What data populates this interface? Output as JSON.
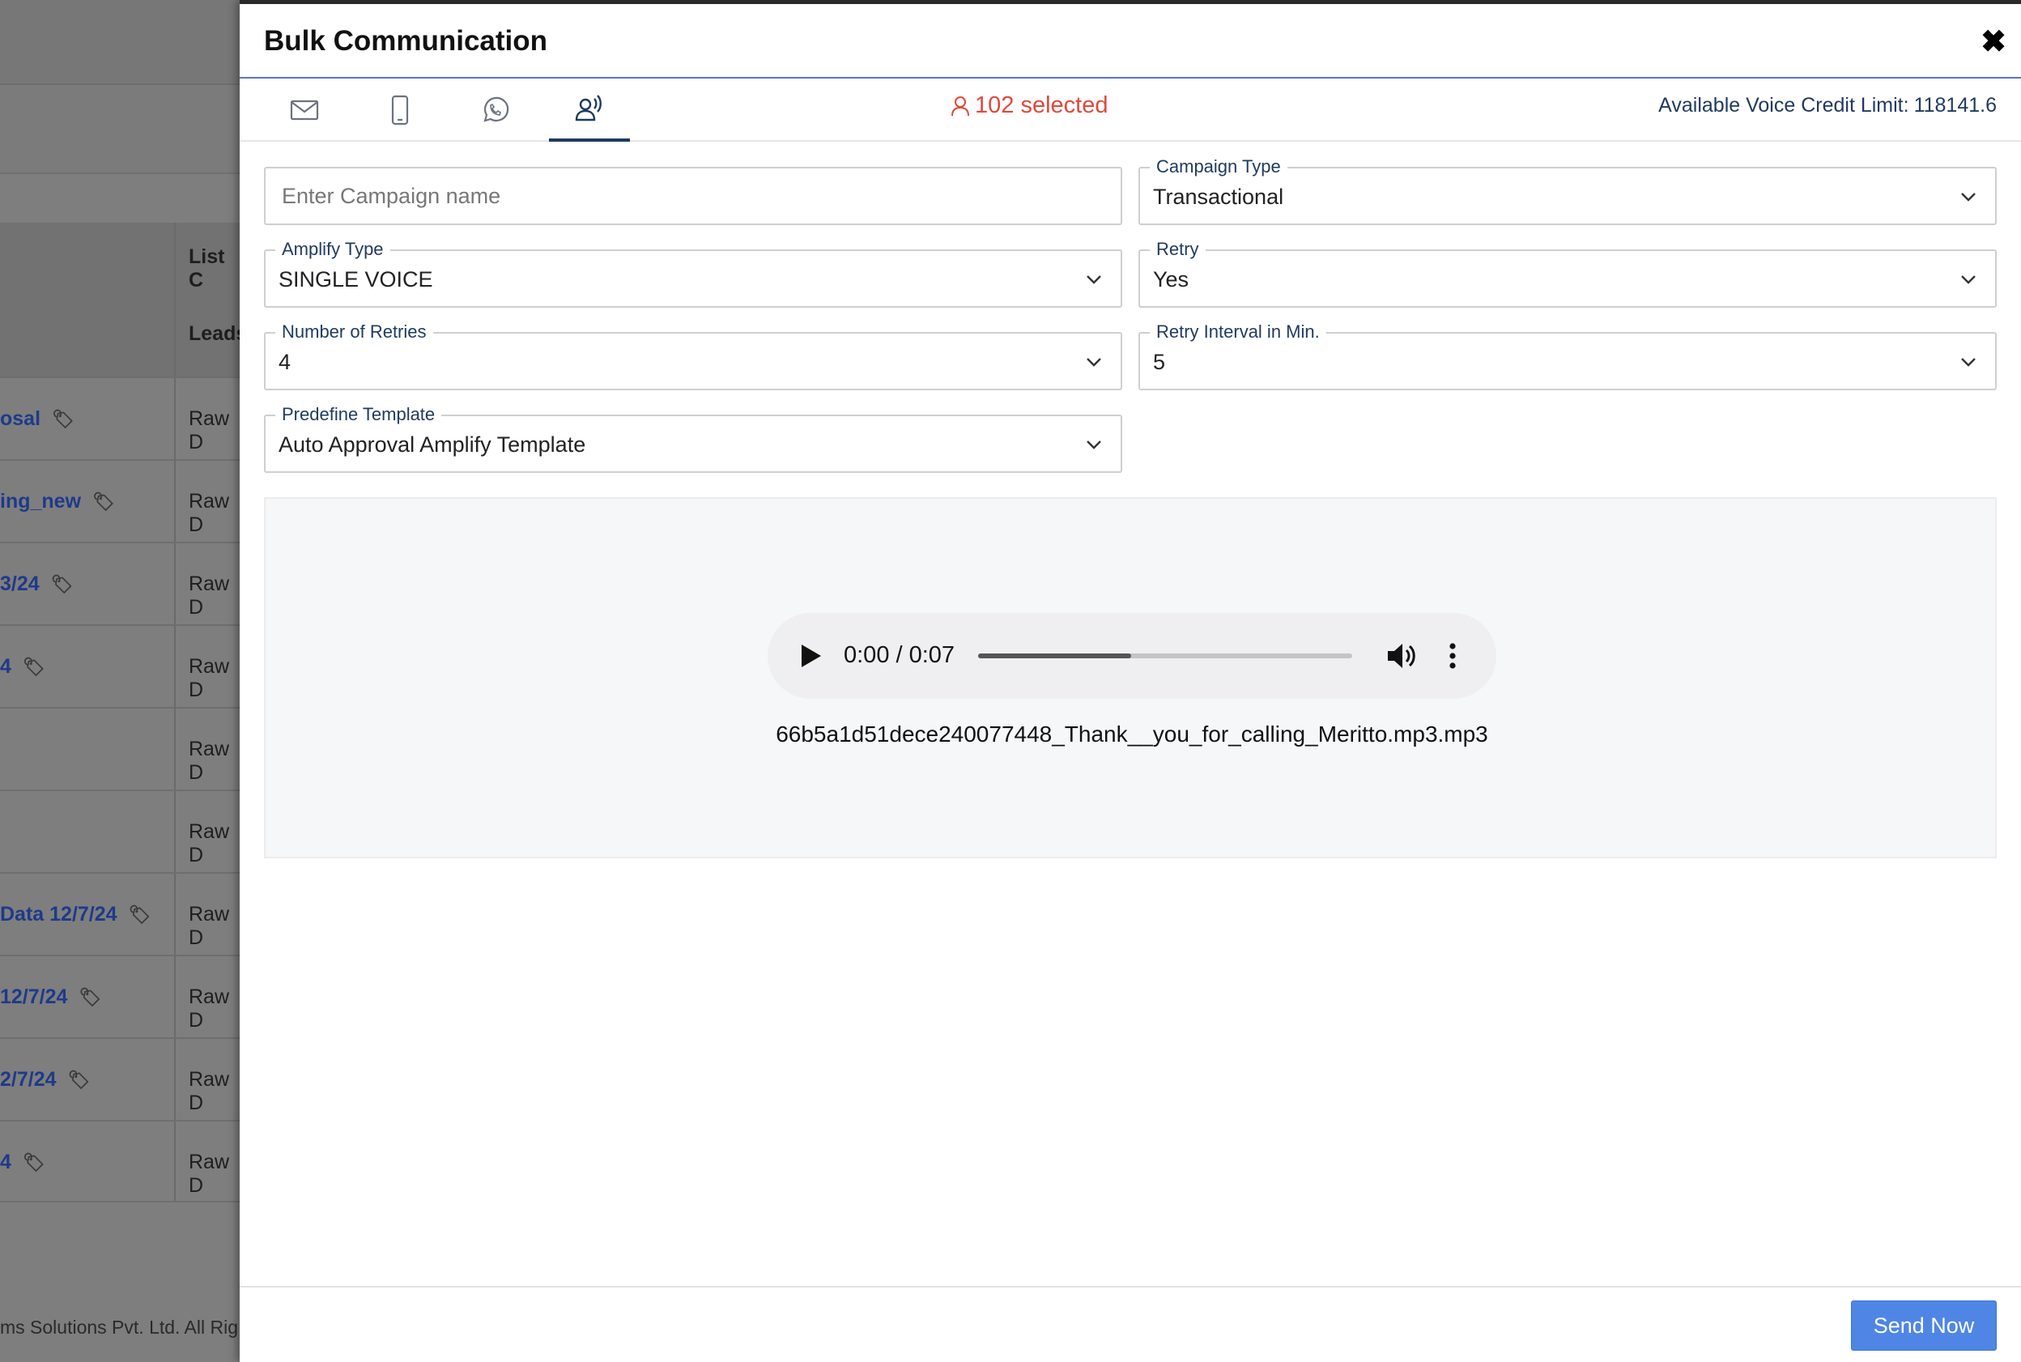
{
  "background": {
    "headers": [
      "List C",
      "Leads"
    ],
    "rows": [
      {
        "name": "osal",
        "type": "Raw D"
      },
      {
        "name": "ing_new",
        "type": "Raw D"
      },
      {
        "name": "3/24",
        "type": "Raw D"
      },
      {
        "name": "4",
        "type": "Raw D"
      },
      {
        "name": "",
        "type": "Raw D"
      },
      {
        "name": "",
        "type": "Raw D"
      },
      {
        "name": "Data 12/7/24",
        "type": "Raw D"
      },
      {
        "name": "12/7/24",
        "type": "Raw D"
      },
      {
        "name": "2/7/24",
        "type": "Raw D"
      },
      {
        "name": "4",
        "type": "Raw D"
      }
    ],
    "footer": "ms Solutions Pvt. Ltd. All Rig"
  },
  "modal": {
    "title": "Bulk Communication",
    "close_icon": "close-icon",
    "tabs": [
      {
        "icon": "email-icon",
        "active": false
      },
      {
        "icon": "mobile-icon",
        "active": false
      },
      {
        "icon": "whatsapp-icon",
        "active": false
      },
      {
        "icon": "voice-icon",
        "active": true
      }
    ],
    "selected_text": "102 selected",
    "credit_label": "Available Voice Credit Limit:",
    "credit_value": "118141.6",
    "campaign_name": {
      "placeholder": "Enter Campaign name",
      "value": ""
    },
    "campaign_type": {
      "label": "Campaign Type",
      "value": "Transactional"
    },
    "amplify_type": {
      "label": "Amplify Type",
      "value": "SINGLE VOICE"
    },
    "retry": {
      "label": "Retry",
      "value": "Yes"
    },
    "number_of_retries": {
      "label": "Number of Retries",
      "value": "4"
    },
    "retry_interval": {
      "label": "Retry Interval in Min.",
      "value": "5"
    },
    "predefine_template": {
      "label": "Predefine Template",
      "value": "Auto Approval Amplify Template"
    },
    "audio": {
      "time_display": "0:00 / 0:07",
      "progress": 0.41,
      "filename": "66b5a1d51dece240077448_Thank__you_for_calling_Meritto.mp3.mp3"
    },
    "send_label": "Send Now"
  },
  "colors": {
    "accent": "#4f86e6",
    "selected_red": "#e0483b",
    "label_navy": "#1f3a5f"
  }
}
